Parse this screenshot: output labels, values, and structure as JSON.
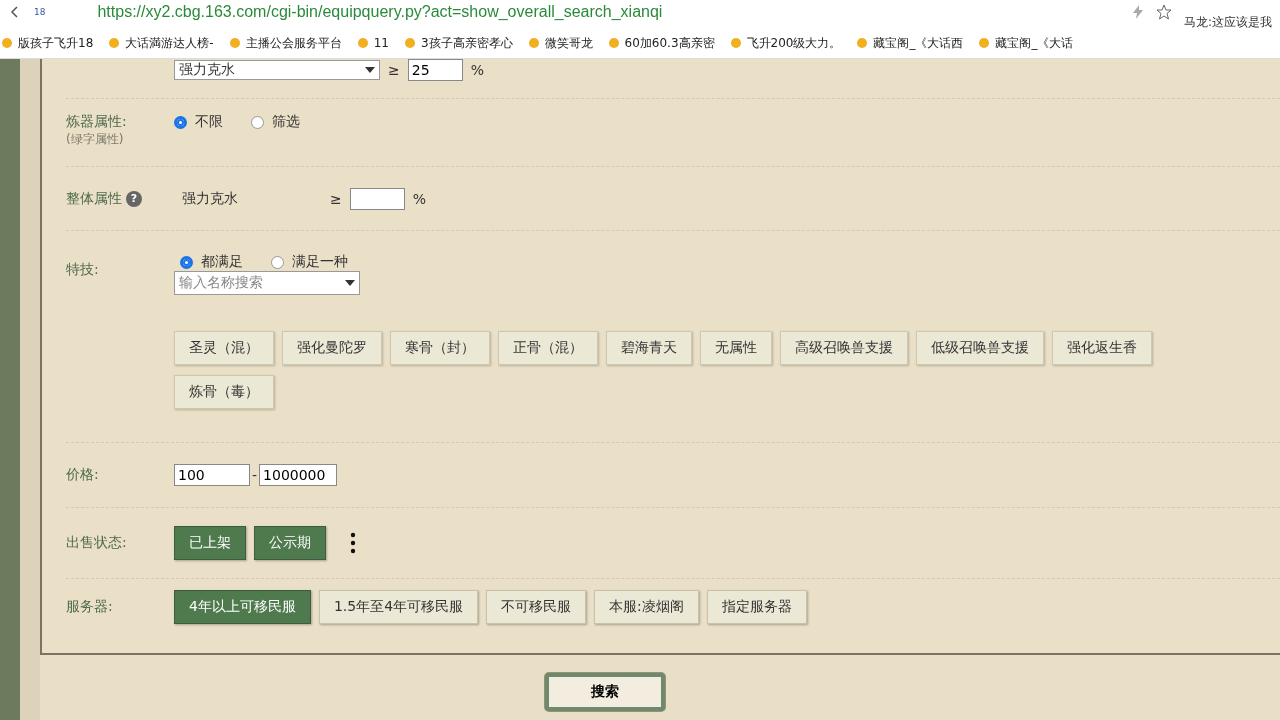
{
  "browser": {
    "url": "https://xy2.cbg.163.com/cgi-bin/equipquery.py?act=show_overall_search_xianqi",
    "tab_count": "18",
    "notification": "马龙:这应该是我",
    "bookmarks": [
      {
        "label": "版孩子飞升18"
      },
      {
        "label": "大话満游达人榜-"
      },
      {
        "label": "主播公会服务平台"
      },
      {
        "label": "11"
      },
      {
        "label": "3孩子高亲密孝心"
      },
      {
        "label": "微笑哥龙"
      },
      {
        "label": "60加60.3高亲密"
      },
      {
        "label": "飞升200级大力。"
      },
      {
        "label": "藏宝阁_《大话西"
      },
      {
        "label": "藏宝阁_《大话"
      }
    ]
  },
  "form": {
    "top_row": {
      "select": "强力克水",
      "operator": "≥",
      "value": "25",
      "unit": "%"
    },
    "refine": {
      "label": "炼器属性:",
      "sublabel": "(绿字属性)",
      "options": [
        {
          "label": "不限",
          "selected": true
        },
        {
          "label": "筛选",
          "selected": false
        }
      ]
    },
    "overall": {
      "label": "整体属性",
      "help": "?",
      "attribute": "强力克水",
      "operator": "≥",
      "unit": "%"
    },
    "skills": {
      "label": "特技:",
      "options": [
        {
          "label": "都满足",
          "selected": true
        },
        {
          "label": "满足一种",
          "selected": false
        }
      ],
      "search": {
        "placeholder": "输入名称搜索"
      },
      "tags": [
        {
          "label": "圣灵（混）"
        },
        {
          "label": "强化曼陀罗"
        },
        {
          "label": "寒骨（封）"
        },
        {
          "label": "正骨（混）"
        },
        {
          "label": "碧海青天"
        },
        {
          "label": "无属性"
        },
        {
          "label": "高级召唤兽支援"
        },
        {
          "label": "低级召唤兽支援"
        },
        {
          "label": "强化返生香"
        },
        {
          "label": "炼骨（毒）"
        }
      ]
    },
    "price": {
      "label": "价格:",
      "min": "100",
      "separator": "-",
      "max": "1000000"
    },
    "sale_status": {
      "label": "出售状态:",
      "options": [
        {
          "label": "已上架",
          "selected": true
        },
        {
          "label": "公示期",
          "selected": true
        }
      ]
    },
    "server": {
      "label": "服务器:",
      "options": [
        {
          "label": "4年以上可移民服",
          "selected": true
        },
        {
          "label": "1.5年至4年可移民服",
          "selected": false
        },
        {
          "label": "不可移民服",
          "selected": false
        },
        {
          "label": "本服:凌烟阁",
          "selected": false
        },
        {
          "label": "指定服务器",
          "selected": false
        }
      ]
    }
  },
  "search_button": "搜索"
}
